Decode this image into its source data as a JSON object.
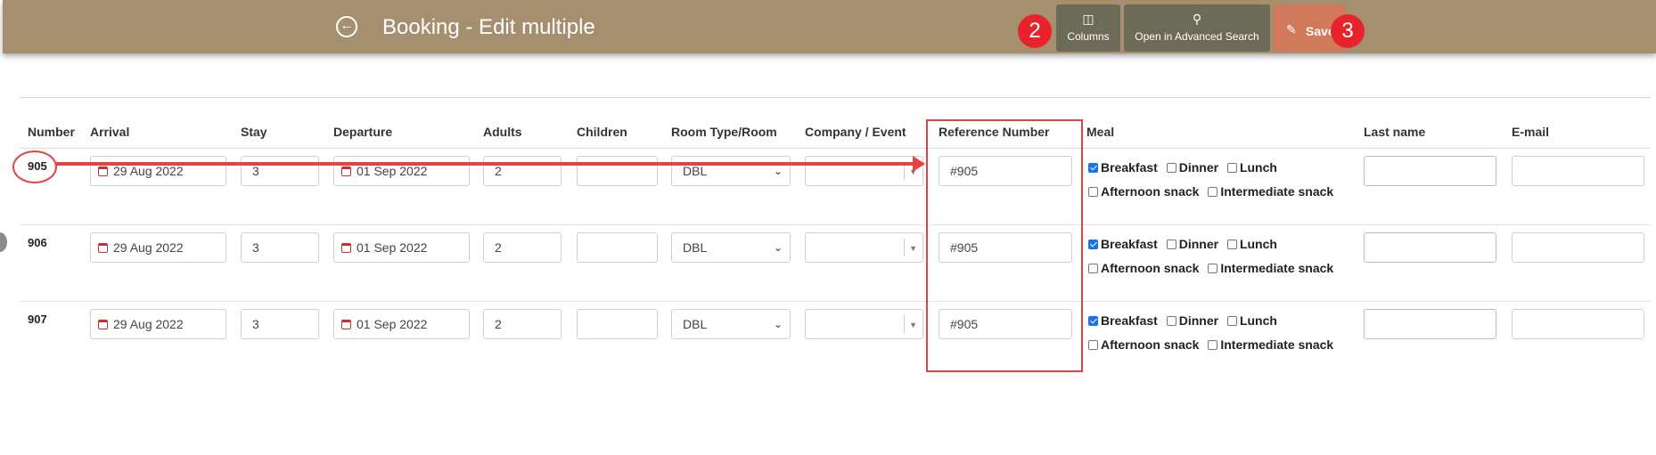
{
  "header": {
    "title": "Booking - Edit multiple",
    "back_icon": "arrow-left-circle-icon",
    "columns_label": "Columns",
    "columns_icon": "columns-icon",
    "advanced_label": "Open in Advanced Search",
    "advanced_icon": "search-icon",
    "save_label": "Save",
    "save_icon": "pencil-icon",
    "bar_color": "#a58f6f",
    "save_color": "#d07a5b"
  },
  "annotations": {
    "badge_columns": "2",
    "badge_save": "3",
    "color": "#e24343"
  },
  "table": {
    "headers": [
      "Number",
      "Arrival",
      "Stay",
      "Departure",
      "Adults",
      "Children",
      "Room Type/Room",
      "Company / Event",
      "Reference Number",
      "Meal",
      "Last name",
      "E-mail"
    ],
    "meal_options": [
      "Breakfast",
      "Dinner",
      "Lunch",
      "Afternoon snack",
      "Intermediate snack"
    ],
    "rows": [
      {
        "number": "905",
        "arrival": "29 Aug 2022",
        "stay": "3",
        "departure": "01 Sep 2022",
        "adults": "2",
        "children": "",
        "room_type": "DBL",
        "company": "",
        "reference": "#905",
        "meals": [
          true,
          false,
          false,
          false,
          false
        ],
        "last_name": "",
        "email": ""
      },
      {
        "number": "906",
        "arrival": "29 Aug 2022",
        "stay": "3",
        "departure": "01 Sep 2022",
        "adults": "2",
        "children": "",
        "room_type": "DBL",
        "company": "",
        "reference": "#905",
        "meals": [
          true,
          false,
          false,
          false,
          false
        ],
        "last_name": "",
        "email": ""
      },
      {
        "number": "907",
        "arrival": "29 Aug 2022",
        "stay": "3",
        "departure": "01 Sep 2022",
        "adults": "2",
        "children": "",
        "room_type": "DBL",
        "company": "",
        "reference": "#905",
        "meals": [
          true,
          false,
          false,
          false,
          false
        ],
        "last_name": "",
        "email": ""
      }
    ]
  }
}
